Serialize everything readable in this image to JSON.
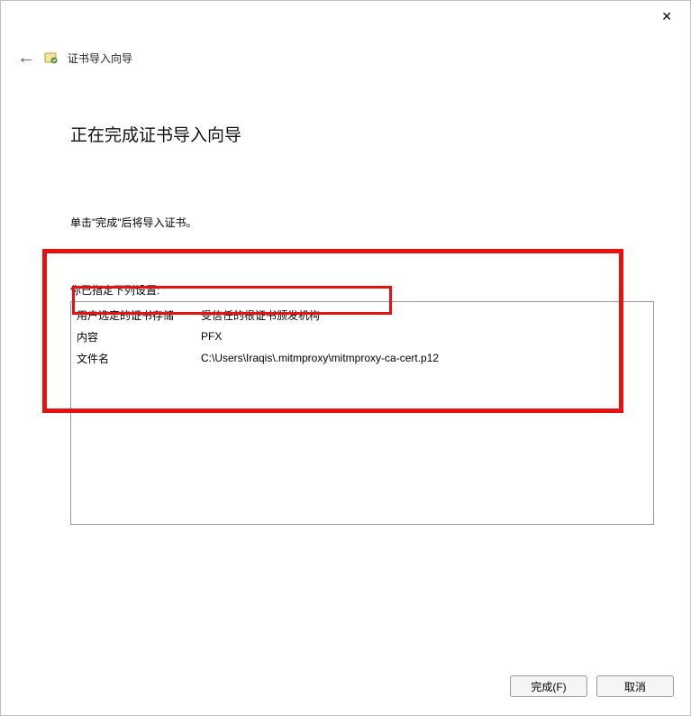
{
  "titlebar": {
    "close_glyph": "✕"
  },
  "header": {
    "back_glyph": "←",
    "wizard_name": "证书导入向导"
  },
  "page": {
    "title": "正在完成证书导入向导",
    "subtitle": "单击\"完成\"后将导入证书。",
    "settings_label": "你已指定下列设置:"
  },
  "settings": {
    "rows": [
      {
        "label": "用户选定的证书存储",
        "value": "受信任的根证书颁发机构"
      },
      {
        "label": "内容",
        "value": "PFX"
      },
      {
        "label": "文件名",
        "value": "C:\\Users\\Iraqis\\.mitmproxy\\mitmproxy-ca-cert.p12"
      }
    ]
  },
  "buttons": {
    "finish": "完成(F)",
    "cancel": "取消"
  }
}
